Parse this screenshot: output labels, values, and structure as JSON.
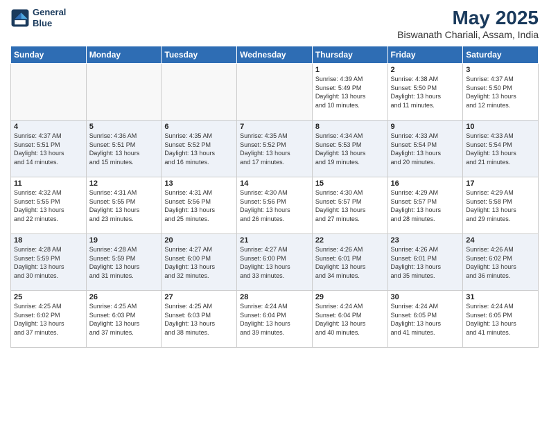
{
  "header": {
    "logo_line1": "General",
    "logo_line2": "Blue",
    "title": "May 2025",
    "subtitle": "Biswanath Chariali, Assam, India"
  },
  "weekdays": [
    "Sunday",
    "Monday",
    "Tuesday",
    "Wednesday",
    "Thursday",
    "Friday",
    "Saturday"
  ],
  "weeks": [
    [
      {
        "day": "",
        "info": ""
      },
      {
        "day": "",
        "info": ""
      },
      {
        "day": "",
        "info": ""
      },
      {
        "day": "",
        "info": ""
      },
      {
        "day": "1",
        "info": "Sunrise: 4:39 AM\nSunset: 5:49 PM\nDaylight: 13 hours\nand 10 minutes."
      },
      {
        "day": "2",
        "info": "Sunrise: 4:38 AM\nSunset: 5:50 PM\nDaylight: 13 hours\nand 11 minutes."
      },
      {
        "day": "3",
        "info": "Sunrise: 4:37 AM\nSunset: 5:50 PM\nDaylight: 13 hours\nand 12 minutes."
      }
    ],
    [
      {
        "day": "4",
        "info": "Sunrise: 4:37 AM\nSunset: 5:51 PM\nDaylight: 13 hours\nand 14 minutes."
      },
      {
        "day": "5",
        "info": "Sunrise: 4:36 AM\nSunset: 5:51 PM\nDaylight: 13 hours\nand 15 minutes."
      },
      {
        "day": "6",
        "info": "Sunrise: 4:35 AM\nSunset: 5:52 PM\nDaylight: 13 hours\nand 16 minutes."
      },
      {
        "day": "7",
        "info": "Sunrise: 4:35 AM\nSunset: 5:52 PM\nDaylight: 13 hours\nand 17 minutes."
      },
      {
        "day": "8",
        "info": "Sunrise: 4:34 AM\nSunset: 5:53 PM\nDaylight: 13 hours\nand 19 minutes."
      },
      {
        "day": "9",
        "info": "Sunrise: 4:33 AM\nSunset: 5:54 PM\nDaylight: 13 hours\nand 20 minutes."
      },
      {
        "day": "10",
        "info": "Sunrise: 4:33 AM\nSunset: 5:54 PM\nDaylight: 13 hours\nand 21 minutes."
      }
    ],
    [
      {
        "day": "11",
        "info": "Sunrise: 4:32 AM\nSunset: 5:55 PM\nDaylight: 13 hours\nand 22 minutes."
      },
      {
        "day": "12",
        "info": "Sunrise: 4:31 AM\nSunset: 5:55 PM\nDaylight: 13 hours\nand 23 minutes."
      },
      {
        "day": "13",
        "info": "Sunrise: 4:31 AM\nSunset: 5:56 PM\nDaylight: 13 hours\nand 25 minutes."
      },
      {
        "day": "14",
        "info": "Sunrise: 4:30 AM\nSunset: 5:56 PM\nDaylight: 13 hours\nand 26 minutes."
      },
      {
        "day": "15",
        "info": "Sunrise: 4:30 AM\nSunset: 5:57 PM\nDaylight: 13 hours\nand 27 minutes."
      },
      {
        "day": "16",
        "info": "Sunrise: 4:29 AM\nSunset: 5:57 PM\nDaylight: 13 hours\nand 28 minutes."
      },
      {
        "day": "17",
        "info": "Sunrise: 4:29 AM\nSunset: 5:58 PM\nDaylight: 13 hours\nand 29 minutes."
      }
    ],
    [
      {
        "day": "18",
        "info": "Sunrise: 4:28 AM\nSunset: 5:59 PM\nDaylight: 13 hours\nand 30 minutes."
      },
      {
        "day": "19",
        "info": "Sunrise: 4:28 AM\nSunset: 5:59 PM\nDaylight: 13 hours\nand 31 minutes."
      },
      {
        "day": "20",
        "info": "Sunrise: 4:27 AM\nSunset: 6:00 PM\nDaylight: 13 hours\nand 32 minutes."
      },
      {
        "day": "21",
        "info": "Sunrise: 4:27 AM\nSunset: 6:00 PM\nDaylight: 13 hours\nand 33 minutes."
      },
      {
        "day": "22",
        "info": "Sunrise: 4:26 AM\nSunset: 6:01 PM\nDaylight: 13 hours\nand 34 minutes."
      },
      {
        "day": "23",
        "info": "Sunrise: 4:26 AM\nSunset: 6:01 PM\nDaylight: 13 hours\nand 35 minutes."
      },
      {
        "day": "24",
        "info": "Sunrise: 4:26 AM\nSunset: 6:02 PM\nDaylight: 13 hours\nand 36 minutes."
      }
    ],
    [
      {
        "day": "25",
        "info": "Sunrise: 4:25 AM\nSunset: 6:02 PM\nDaylight: 13 hours\nand 37 minutes."
      },
      {
        "day": "26",
        "info": "Sunrise: 4:25 AM\nSunset: 6:03 PM\nDaylight: 13 hours\nand 37 minutes."
      },
      {
        "day": "27",
        "info": "Sunrise: 4:25 AM\nSunset: 6:03 PM\nDaylight: 13 hours\nand 38 minutes."
      },
      {
        "day": "28",
        "info": "Sunrise: 4:24 AM\nSunset: 6:04 PM\nDaylight: 13 hours\nand 39 minutes."
      },
      {
        "day": "29",
        "info": "Sunrise: 4:24 AM\nSunset: 6:04 PM\nDaylight: 13 hours\nand 40 minutes."
      },
      {
        "day": "30",
        "info": "Sunrise: 4:24 AM\nSunset: 6:05 PM\nDaylight: 13 hours\nand 41 minutes."
      },
      {
        "day": "31",
        "info": "Sunrise: 4:24 AM\nSunset: 6:05 PM\nDaylight: 13 hours\nand 41 minutes."
      }
    ]
  ]
}
